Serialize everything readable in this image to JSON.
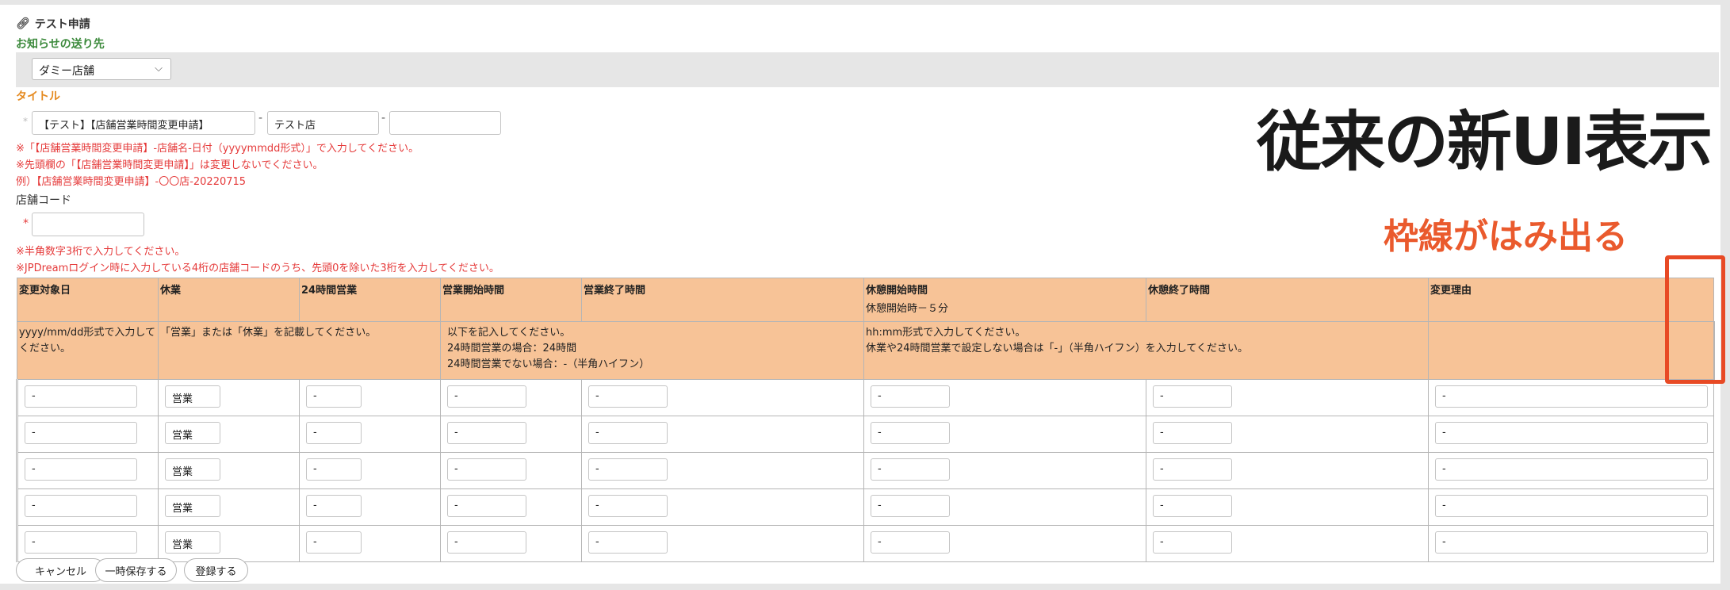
{
  "form": {
    "title": "テスト申請",
    "title_icon": "clip-icon"
  },
  "notify": {
    "label": "お知らせの送り先",
    "selected": "ダミー店舗"
  },
  "title_section": {
    "label": "タイトル",
    "required_mark": "*",
    "field1": "【テスト】【店舗営業時間変更申請】",
    "field2": "テスト店",
    "field3": "",
    "separator": "-",
    "notes": [
      "※「【店舗営業時間変更申請】-店舗名-日付（yyyymmdd形式）」で入力してください。",
      "※先頭欄の「【店舗営業時間変更申請】」は変更しないでください。",
      "例）【店舗営業時間変更申請】-〇〇店-20220715"
    ]
  },
  "store_code": {
    "label": "店舗コード",
    "required_mark": "*",
    "value": "",
    "notes": [
      "※半角数字3桁で入力してください。",
      "※JPDreamログイン時に入力している4桁の店舗コードのうち、先頭0を除いた3桁を入力してください。"
    ]
  },
  "annotation": {
    "headline": "従来の新UI表示",
    "callout": "枠線がはみ出る",
    "accent_color": "#ea5a2d"
  },
  "table": {
    "header_color": "#f7c397",
    "headers": [
      {
        "label": "変更対象日",
        "sub": ""
      },
      {
        "label": "休業",
        "sub": ""
      },
      {
        "label": "24時間営業",
        "sub": ""
      },
      {
        "label": "営業開始時間",
        "sub": ""
      },
      {
        "label": "営業終了時間",
        "sub": ""
      },
      {
        "label": "休憩開始時間",
        "sub": "休憩開始時－５分"
      },
      {
        "label": "休憩終了時間",
        "sub": ""
      },
      {
        "label": "変更理由",
        "sub": ""
      }
    ],
    "hints": {
      "date": "yyyy/mm/dd形式で入力してください。",
      "closed": "「営業」または「休業」を記載してください。",
      "open24_line1": "以下を記入してください。",
      "open24_line2": "24時間営業の場合：24時間",
      "open24_line3": "24時間営業でない場合：-（半角ハイフン）",
      "time_line1": "hh:mm形式で入力してください。",
      "time_line2": "休業や24時間営業で設定しない場合は「-」（半角ハイフン）を入力してください。",
      "reason": ""
    },
    "rows": [
      {
        "date": "-",
        "closed": "営業",
        "open24": "-",
        "start": "-",
        "end": "-",
        "break_start": "-",
        "break_end": "-",
        "reason": "-"
      },
      {
        "date": "-",
        "closed": "営業",
        "open24": "-",
        "start": "-",
        "end": "-",
        "break_start": "-",
        "break_end": "-",
        "reason": "-"
      },
      {
        "date": "-",
        "closed": "営業",
        "open24": "-",
        "start": "-",
        "end": "-",
        "break_start": "-",
        "break_end": "-",
        "reason": "-"
      },
      {
        "date": "-",
        "closed": "営業",
        "open24": "-",
        "start": "-",
        "end": "-",
        "break_start": "-",
        "break_end": "-",
        "reason": "-"
      },
      {
        "date": "-",
        "closed": "営業",
        "open24": "-",
        "start": "-",
        "end": "-",
        "break_start": "-",
        "break_end": "-",
        "reason": "-"
      }
    ]
  },
  "buttons": {
    "cancel": "キャンセル",
    "save_draft": "一時保存する",
    "submit": "登録する"
  }
}
